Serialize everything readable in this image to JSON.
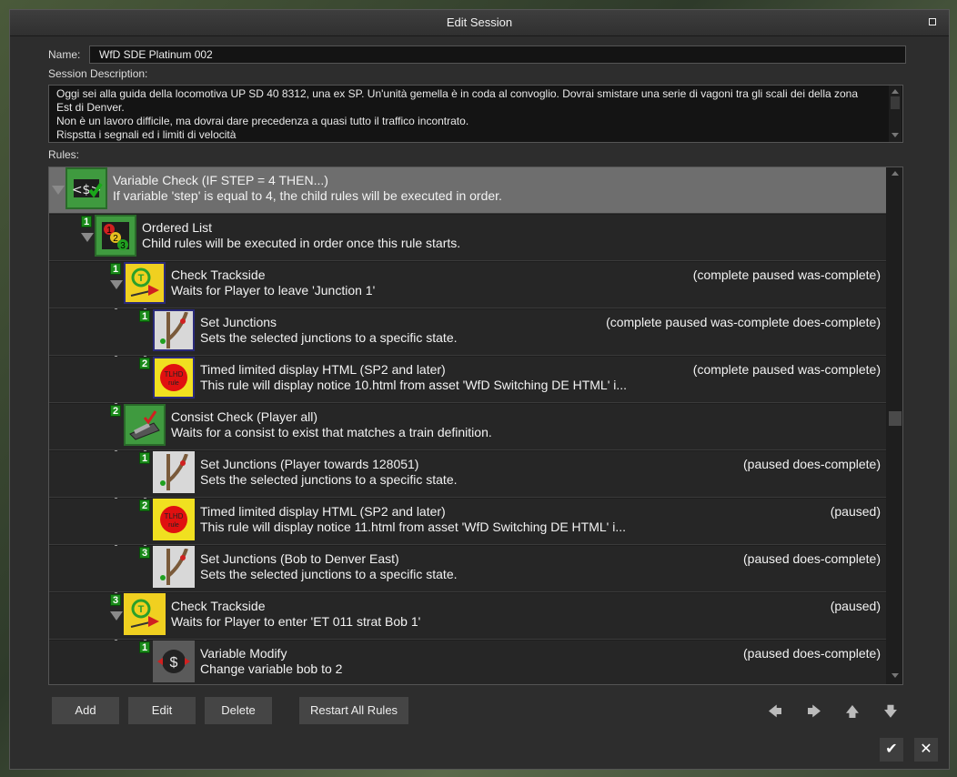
{
  "dialog": {
    "title": "Edit Session"
  },
  "name": {
    "label": "Name:",
    "value": "WfD SDE Platinum 002"
  },
  "description": {
    "label": "Session Description:",
    "lines": [
      "Oggi sei alla guida della locomotiva UP SD 40 8312, una ex SP. Un'unità gemella è in coda al convoglio. Dovrai smistare una serie di vagoni tra gli scali dei della zona",
      "Est di Denver.",
      "Non è un lavoro difficile, ma dovrai dare precedenza a quasi tutto il traffico incontrato.",
      "Rispstta i segnali ed i limiti di velocità"
    ]
  },
  "rules": {
    "label": "Rules:",
    "items": [
      {
        "badge": "",
        "icon": "variable-check-icon",
        "title": "Variable Check  (IF STEP = 4 THEN...)",
        "desc": "If variable 'step' is equal to 4, the child rules will be executed in order.",
        "status": ""
      },
      {
        "badge": "1",
        "icon": "ordered-list-icon",
        "title": "Ordered List",
        "desc": "Child rules will be executed in order once this rule starts.",
        "status": ""
      },
      {
        "badge": "1",
        "icon": "check-trackside-icon",
        "title": "Check Trackside",
        "desc": "Waits for Player to leave 'Junction 1'",
        "status": "(complete paused was-complete)"
      },
      {
        "badge": "1",
        "icon": "set-junctions-icon",
        "title": "Set Junctions",
        "desc": "Sets the selected junctions to a specific state.",
        "status": "(complete paused was-complete does-complete)"
      },
      {
        "badge": "2",
        "icon": "timed-display-icon",
        "title": "Timed limited display HTML (SP2 and later)",
        "desc": "This rule will display notice 10.html from asset 'WfD Switching DE HTML' i...",
        "status": "(complete paused was-complete)"
      },
      {
        "badge": "2",
        "icon": "consist-check-icon",
        "title": "Consist Check  (Player  all)",
        "desc": "Waits for a consist to exist that matches a train definition.",
        "status": ""
      },
      {
        "badge": "1",
        "icon": "set-junctions-icon",
        "title": "Set Junctions  (Player towards 128051)",
        "desc": "Sets the selected junctions to a specific state.",
        "status": "(paused does-complete)"
      },
      {
        "badge": "2",
        "icon": "timed-display-icon",
        "title": "Timed limited display HTML (SP2 and later)",
        "desc": "This rule will display notice 11.html from asset 'WfD Switching DE HTML' i...",
        "status": "(paused)"
      },
      {
        "badge": "3",
        "icon": "set-junctions-icon",
        "title": "Set Junctions  (Bob to Denver East)",
        "desc": "Sets the selected junctions to a specific state.",
        "status": "(paused does-complete)"
      },
      {
        "badge": "3",
        "icon": "check-trackside-icon",
        "title": "Check Trackside",
        "desc": "Waits for Player to enter 'ET 011 strat Bob 1'",
        "status": "(paused)"
      },
      {
        "badge": "1",
        "icon": "variable-modify-icon",
        "title": "Variable Modify",
        "desc": "Change variable bob to 2",
        "status": "(paused does-complete)"
      }
    ]
  },
  "buttons": {
    "add": "Add",
    "edit": "Edit",
    "delete": "Delete",
    "restart": "Restart All Rules"
  },
  "nav": [
    "arrow-left-icon",
    "arrow-right-icon",
    "arrow-up-icon",
    "arrow-down-icon"
  ],
  "footer": {
    "ok": "✔",
    "cancel": "✕"
  },
  "tlhd_text": "TLHD rule"
}
